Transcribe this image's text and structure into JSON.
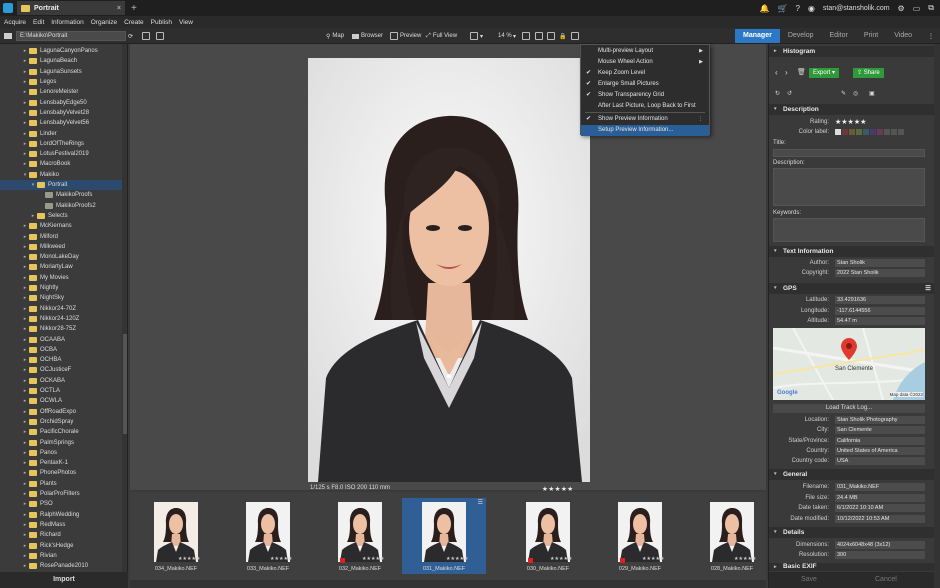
{
  "title_bar": {
    "tab_label": "Portrait",
    "user": "stan@stansholik.com"
  },
  "menu": [
    "Acquire",
    "Edit",
    "Information",
    "Organize",
    "Create",
    "Publish",
    "View"
  ],
  "toolbar": {
    "path": "E:\\Makiko\\Portrait",
    "map": "Map",
    "browser": "Browser",
    "preview": "Preview",
    "full_view": "Full View",
    "zoom": "14 %"
  },
  "modes": [
    "Manager",
    "Develop",
    "Editor",
    "Print",
    "Video"
  ],
  "tree": [
    {
      "label": "LagunaCanyonPanos",
      "level": 1
    },
    {
      "label": "LagunaBeach",
      "level": 1
    },
    {
      "label": "LagunaSunsets",
      "level": 1
    },
    {
      "label": "Legos",
      "level": 1
    },
    {
      "label": "LenoreMeister",
      "level": 1
    },
    {
      "label": "LensbabyEdge50",
      "level": 1
    },
    {
      "label": "LensbabyVelvet28",
      "level": 1
    },
    {
      "label": "LensbabyVelvet56",
      "level": 1
    },
    {
      "label": "Linder",
      "level": 1
    },
    {
      "label": "LordOfTheRings",
      "level": 1
    },
    {
      "label": "LotusFestival2019",
      "level": 1
    },
    {
      "label": "MacroBook",
      "level": 1
    },
    {
      "label": "Makiko",
      "level": 1,
      "open": true
    },
    {
      "label": "Portrait",
      "level": 2,
      "open": true,
      "selected": true
    },
    {
      "label": "MakikoProofs",
      "level": 3
    },
    {
      "label": "MakikoProofs2",
      "level": 3
    },
    {
      "label": "Selects",
      "level": 2
    },
    {
      "label": "McKiernans",
      "level": 1
    },
    {
      "label": "Milford",
      "level": 1
    },
    {
      "label": "Milkweed",
      "level": 1
    },
    {
      "label": "MonoLakeDay",
      "level": 1
    },
    {
      "label": "MoriartyLaw",
      "level": 1
    },
    {
      "label": "My Movies",
      "level": 1
    },
    {
      "label": "Nightly",
      "level": 1
    },
    {
      "label": "NightSky",
      "level": 1
    },
    {
      "label": "Nikkor24-70Z",
      "level": 1
    },
    {
      "label": "Nikkor24-120Z",
      "level": 1
    },
    {
      "label": "Nikkor28-75Z",
      "level": 1
    },
    {
      "label": "OCAABA",
      "level": 1
    },
    {
      "label": "OCBA",
      "level": 1
    },
    {
      "label": "OCHBA",
      "level": 1
    },
    {
      "label": "OCJusticeF",
      "level": 1
    },
    {
      "label": "OCKABA",
      "level": 1
    },
    {
      "label": "OCTLA",
      "level": 1
    },
    {
      "label": "OCWLA",
      "level": 1
    },
    {
      "label": "OffRoadExpo",
      "level": 1
    },
    {
      "label": "OrchidSpray",
      "level": 1
    },
    {
      "label": "PacificChorale",
      "level": 1
    },
    {
      "label": "PalmSprings",
      "level": 1
    },
    {
      "label": "Panos",
      "level": 1
    },
    {
      "label": "PentaxK-1",
      "level": 1
    },
    {
      "label": "PhonePhotos",
      "level": 1
    },
    {
      "label": "Plants",
      "level": 1
    },
    {
      "label": "PolarProFilters",
      "level": 1
    },
    {
      "label": "PSO",
      "level": 1
    },
    {
      "label": "RalphWedding",
      "level": 1
    },
    {
      "label": "RedMass",
      "level": 1
    },
    {
      "label": "Richard",
      "level": 1
    },
    {
      "label": "Rick'sHedge",
      "level": 1
    },
    {
      "label": "Rivian",
      "level": 1
    },
    {
      "label": "RosePanade2010",
      "level": 1
    }
  ],
  "import_label": "Import",
  "context_menu": [
    {
      "label": "Multi-preview Layout",
      "checked": false,
      "submenu": true
    },
    {
      "label": "Mouse Wheel Action",
      "checked": false,
      "submenu": true
    },
    {
      "label": "Keep Zoom Level",
      "checked": true
    },
    {
      "label": "Enlarge Small Pictures",
      "checked": true
    },
    {
      "label": "Show Transparency Grid",
      "checked": true
    },
    {
      "label": "After Last Picture, Loop Back to First",
      "checked": false
    },
    {
      "label": "Show Preview Information",
      "checked": true,
      "more": true
    },
    {
      "label": "Setup Preview Information...",
      "checked": false,
      "highlight": true
    }
  ],
  "preview_info": "1/125 s   F8.0   ISO 200   110 mm",
  "preview_stars": "★★★★★",
  "thumbnails": [
    {
      "label": "034_Makiko.NEF",
      "stars": "★★★★★",
      "flag": false,
      "selected": false,
      "bg": "light"
    },
    {
      "label": "033_Makiko.NEF",
      "stars": "★★★★★",
      "flag": false,
      "selected": false,
      "bg": "white"
    },
    {
      "label": "032_Makiko.NEF",
      "stars": "★★★★★",
      "flag": true,
      "selected": false,
      "bg": "white"
    },
    {
      "label": "031_Makiko.NEF",
      "stars": "★★★★★",
      "flag": false,
      "selected": true,
      "bg": "white"
    },
    {
      "label": "030_Makiko.NEF",
      "stars": "★★★★★",
      "flag": true,
      "selected": false,
      "bg": "white"
    },
    {
      "label": "029_Makiko.NEF",
      "stars": "★★★★★",
      "flag": true,
      "selected": false,
      "bg": "white"
    },
    {
      "label": "028_Makiko.NEF",
      "stars": "★★★★★",
      "flag": false,
      "selected": false,
      "bg": "white"
    }
  ],
  "right_panel": {
    "histogram": "Histogram",
    "export": "Export",
    "share": "Share",
    "description": {
      "header": "Description",
      "rating_label": "Rating:",
      "rating": "★★★★★",
      "color_label": "Color label:",
      "title": "Title:",
      "description": "Description:",
      "keywords": "Keywords:"
    },
    "text_info": {
      "header": "Text Information",
      "rows": [
        {
          "label": "Author:",
          "value": "Stan Sholik"
        },
        {
          "label": "Copyright:",
          "value": "2022 Stan Sholik"
        }
      ]
    },
    "gps": {
      "header": "GPS",
      "rows": [
        {
          "label": "Latitude:",
          "value": "33.4291636"
        },
        {
          "label": "Longitude:",
          "value": "-117.6144556"
        },
        {
          "label": "Altitude:",
          "value": "54.47 m"
        }
      ],
      "map_city": "San Clemente",
      "map_attrib": "Map data ©2022",
      "map_brand": "Google",
      "load_track": "Load Track Log...",
      "location_rows": [
        {
          "label": "Location:",
          "value": "Stan Sholik Photography"
        },
        {
          "label": "City:",
          "value": "San Clemente"
        },
        {
          "label": "State/Province:",
          "value": "California"
        },
        {
          "label": "Country:",
          "value": "United States of America"
        },
        {
          "label": "Country code:",
          "value": "USA"
        }
      ]
    },
    "general": {
      "header": "General",
      "rows": [
        {
          "label": "Filename:",
          "value": "031_Makiko.NEF"
        },
        {
          "label": "File size:",
          "value": "24.4 MB"
        },
        {
          "label": "Date taken:",
          "value": "6/1/2022 10:10 AM"
        },
        {
          "label": "Date modified:",
          "value": "10/12/2022 10:53 AM"
        }
      ]
    },
    "details": {
      "header": "Details",
      "rows": [
        {
          "label": "Dimensions:",
          "value": "4024x6048x48 (3x12)"
        },
        {
          "label": "Resolution:",
          "value": "300"
        }
      ]
    },
    "basic_exif": "Basic EXIF",
    "save": "Save",
    "cancel": "Cancel"
  },
  "colors": {
    "accent": "#2a78c6",
    "folder": "#e6c65a",
    "export_green": "#2e9a3a",
    "flag_red": "#e02020"
  }
}
